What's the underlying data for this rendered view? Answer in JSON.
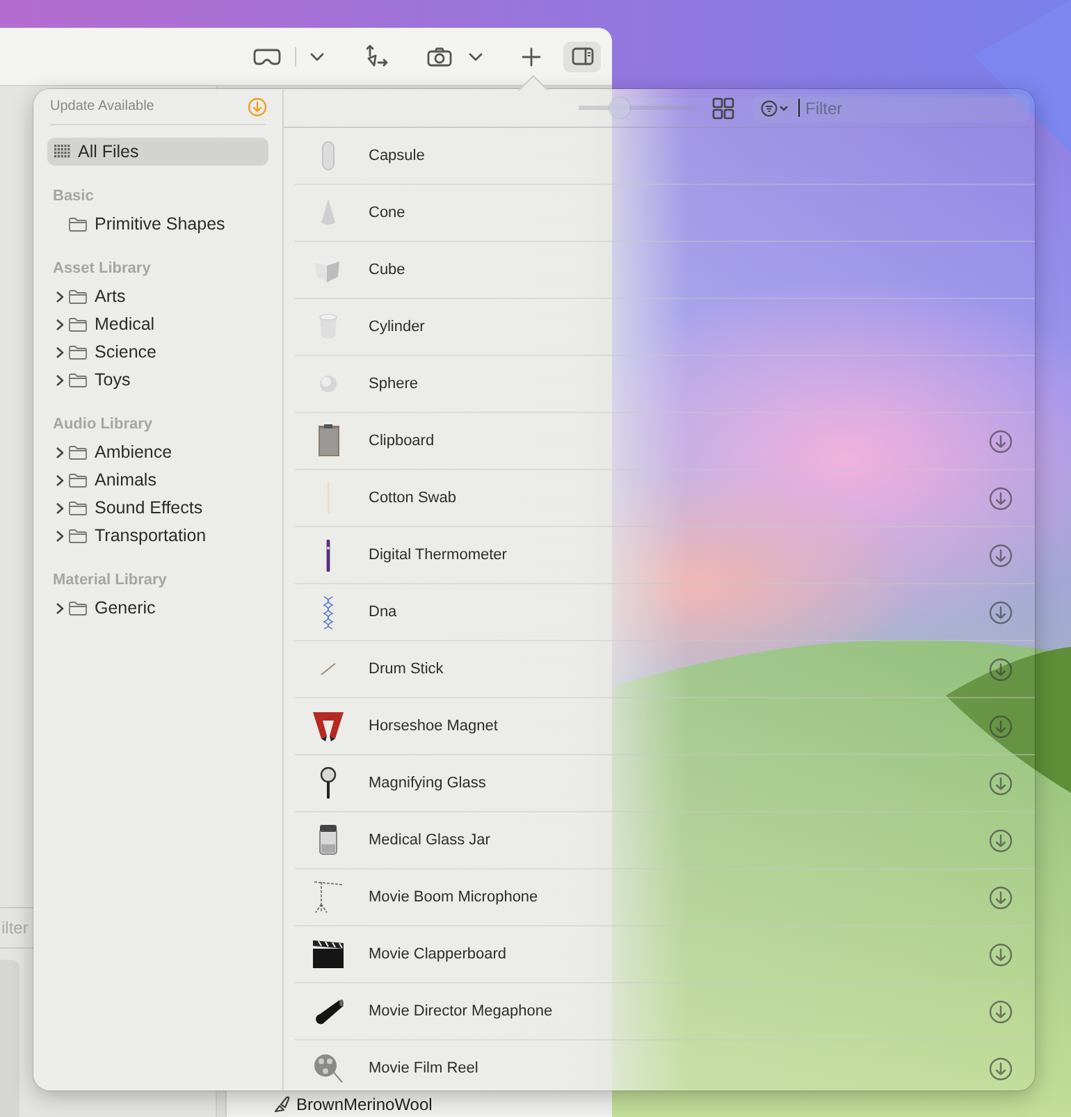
{
  "background_window": {
    "sidebar_toggle": {
      "selected": true
    },
    "filter_placeholder": "ilter",
    "material_item": "BrownMerinoWool"
  },
  "library": {
    "update_label": "Update Available",
    "all_files": {
      "label": "All Files",
      "selected": true
    },
    "sections": [
      {
        "title": "Basic",
        "items": [
          {
            "label": "Primitive Shapes"
          }
        ]
      },
      {
        "title": "Asset Library",
        "items": [
          {
            "label": "Arts",
            "expanded": false
          },
          {
            "label": "Medical",
            "expanded": false
          },
          {
            "label": "Science",
            "expanded": false
          },
          {
            "label": "Toys",
            "expanded": false
          }
        ]
      },
      {
        "title": "Audio Library",
        "items": [
          {
            "label": "Ambience",
            "expanded": false
          },
          {
            "label": "Animals",
            "expanded": false
          },
          {
            "label": "Sound Effects",
            "expanded": false
          },
          {
            "label": "Transportation",
            "expanded": false
          }
        ]
      },
      {
        "title": "Material Library",
        "items": [
          {
            "label": "Generic",
            "expanded": false
          }
        ]
      }
    ],
    "zoom_slider": {
      "level": 0.32
    },
    "filter": {
      "placeholder": "Filter"
    },
    "items": [
      {
        "name": "Capsule",
        "downloadable": false
      },
      {
        "name": "Cone",
        "downloadable": false
      },
      {
        "name": "Cube",
        "downloadable": false
      },
      {
        "name": "Cylinder",
        "downloadable": false
      },
      {
        "name": "Sphere",
        "downloadable": false
      },
      {
        "name": "Clipboard",
        "downloadable": true
      },
      {
        "name": "Cotton Swab",
        "downloadable": true
      },
      {
        "name": "Digital Thermometer",
        "downloadable": true
      },
      {
        "name": "Dna",
        "downloadable": true
      },
      {
        "name": "Drum Stick",
        "downloadable": true
      },
      {
        "name": "Horseshoe Magnet",
        "downloadable": true
      },
      {
        "name": "Magnifying Glass",
        "downloadable": true
      },
      {
        "name": "Medical Glass Jar",
        "downloadable": true
      },
      {
        "name": "Movie Boom Microphone",
        "downloadable": true
      },
      {
        "name": "Movie Clapperboard",
        "downloadable": true
      },
      {
        "name": "Movie Director Megaphone",
        "downloadable": true
      },
      {
        "name": "Movie Film Reel",
        "downloadable": true
      }
    ]
  }
}
